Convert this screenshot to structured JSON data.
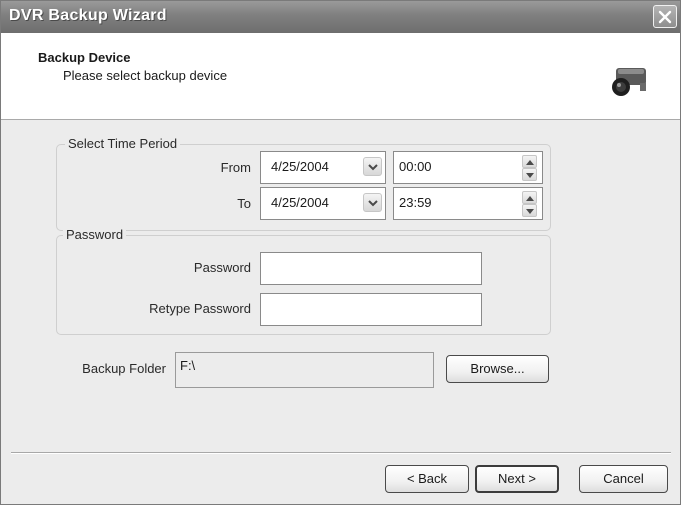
{
  "window": {
    "title": "DVR Backup Wizard"
  },
  "header": {
    "title": "Backup Device",
    "subtitle": "Please select backup device",
    "icon": "camera-icon"
  },
  "time_period": {
    "legend": "Select Time Period",
    "from_label": "From",
    "from_date": "4/25/2004",
    "from_time": "00:00",
    "to_label": "To",
    "to_date": "4/25/2004",
    "to_time": "23:59"
  },
  "password_group": {
    "legend": "Password",
    "password_label": "Password",
    "password_value": "",
    "retype_label": "Retype Password",
    "retype_value": ""
  },
  "backup_folder": {
    "label": "Backup Folder",
    "value": "F:\\",
    "browse_label": "Browse..."
  },
  "buttons": {
    "back": "< Back",
    "next": "Next >",
    "cancel": "Cancel"
  }
}
